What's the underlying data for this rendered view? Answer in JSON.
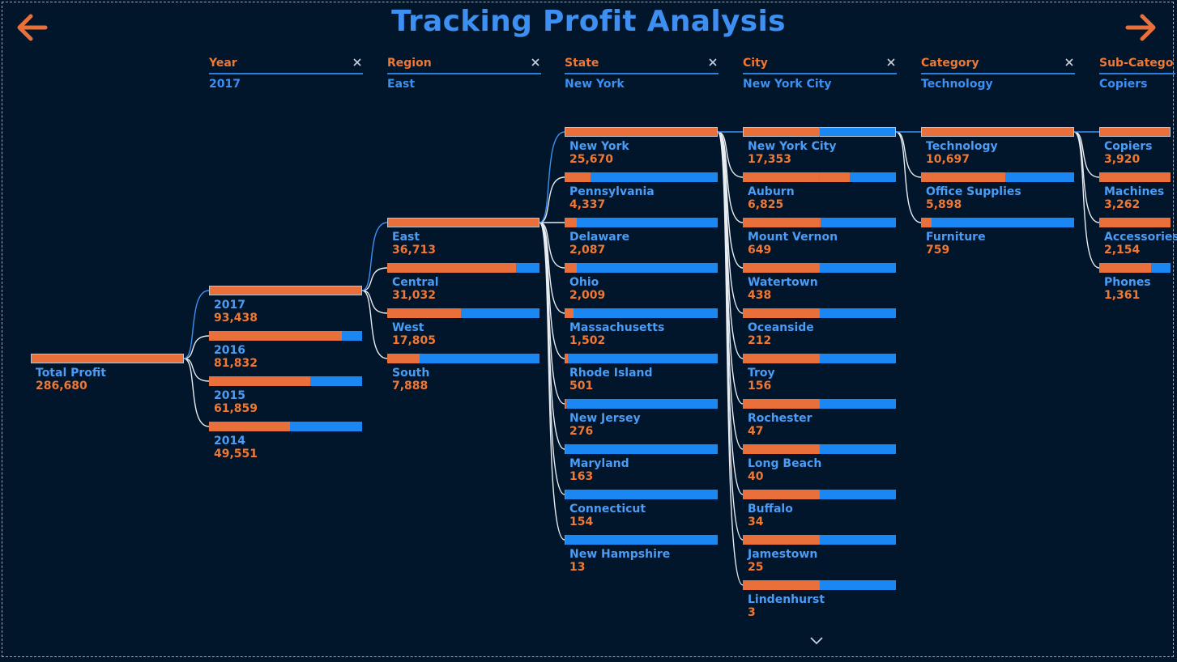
{
  "title": "Tracking Profit Analysis",
  "colors": {
    "background": "#01162b",
    "profit": "#e9703a",
    "bar_base": "#1a87f2",
    "title": "#3d8ff2",
    "label": "#f07835"
  },
  "icons": {
    "back": "arrow-left-icon",
    "forward": "arrow-right-icon",
    "close": "close-icon",
    "scroll": "chevron-down-icon"
  },
  "levels": [
    {
      "header": "",
      "selected": "",
      "nodes": [
        {
          "name": "Total Profit",
          "value": "286,680",
          "fill": 1.0,
          "active": true
        }
      ]
    },
    {
      "header": "Year",
      "selected": "2017",
      "nodes": [
        {
          "name": "2017",
          "value": "93,438",
          "fill": 1.0,
          "active": true
        },
        {
          "name": "2016",
          "value": "81,832",
          "fill": 0.87,
          "active": false
        },
        {
          "name": "2015",
          "value": "61,859",
          "fill": 0.66,
          "active": false
        },
        {
          "name": "2014",
          "value": "49,551",
          "fill": 0.53,
          "active": false
        }
      ]
    },
    {
      "header": "Region",
      "selected": "East",
      "nodes": [
        {
          "name": "East",
          "value": "36,713",
          "fill": 1.0,
          "active": true
        },
        {
          "name": "Central",
          "value": "31,032",
          "fill": 0.845,
          "active": false
        },
        {
          "name": "West",
          "value": "17,805",
          "fill": 0.485,
          "active": false
        },
        {
          "name": "South",
          "value": "7,888",
          "fill": 0.215,
          "active": false
        }
      ]
    },
    {
      "header": "State",
      "selected": "New York",
      "nodes": [
        {
          "name": "New York",
          "value": "25,670",
          "fill": 1.0,
          "active": true
        },
        {
          "name": "Pennsylvania",
          "value": "4,337",
          "fill": 0.169,
          "active": false
        },
        {
          "name": "Delaware",
          "value": "2,087",
          "fill": 0.081,
          "active": false
        },
        {
          "name": "Ohio",
          "value": "2,009",
          "fill": 0.078,
          "active": false
        },
        {
          "name": "Massachusetts",
          "value": "1,502",
          "fill": 0.059,
          "active": false
        },
        {
          "name": "Rhode Island",
          "value": "501",
          "fill": 0.02,
          "active": false
        },
        {
          "name": "New Jersey",
          "value": "276",
          "fill": 0.011,
          "active": false
        },
        {
          "name": "Maryland",
          "value": "163",
          "fill": 0.006,
          "active": false
        },
        {
          "name": "Connecticut",
          "value": "154",
          "fill": 0.006,
          "active": false
        },
        {
          "name": "New Hampshire",
          "value": "13",
          "fill": 0.0005,
          "active": false
        }
      ]
    },
    {
      "header": "City",
      "selected": "New York City",
      "nodes": [
        {
          "name": "New York City",
          "value": "17,353",
          "fill": 0.5,
          "active": true
        },
        {
          "name": "Auburn",
          "value": "6,825",
          "fill": 0.7,
          "active": false
        },
        {
          "name": "Mount Vernon",
          "value": "649",
          "fill": 0.51,
          "active": false
        },
        {
          "name": "Watertown",
          "value": "438",
          "fill": 0.505,
          "active": false
        },
        {
          "name": "Oceanside",
          "value": "212",
          "fill": 0.5,
          "active": false
        },
        {
          "name": "Troy",
          "value": "156",
          "fill": 0.5,
          "active": false
        },
        {
          "name": "Rochester",
          "value": "47",
          "fill": 0.5,
          "active": false
        },
        {
          "name": "Long Beach",
          "value": "40",
          "fill": 0.5,
          "active": false
        },
        {
          "name": "Buffalo",
          "value": "34",
          "fill": 0.5,
          "active": false
        },
        {
          "name": "Jamestown",
          "value": "25",
          "fill": 0.5,
          "active": false
        },
        {
          "name": "Lindenhurst",
          "value": "3",
          "fill": 0.5,
          "active": false
        }
      ]
    },
    {
      "header": "Category",
      "selected": "Technology",
      "nodes": [
        {
          "name": "Technology",
          "value": "10,697",
          "fill": 1.0,
          "active": true
        },
        {
          "name": "Office Supplies",
          "value": "5,898",
          "fill": 0.551,
          "active": false
        },
        {
          "name": "Furniture",
          "value": "759",
          "fill": 0.071,
          "active": false
        }
      ]
    },
    {
      "header": "Sub-Catego",
      "selected": "Copiers",
      "nodes": [
        {
          "name": "Copiers",
          "value": "3,920",
          "fill": 1.0,
          "active": true
        },
        {
          "name": "Machines",
          "value": "3,262",
          "fill": 1.0,
          "active": false
        },
        {
          "name": "Accessories",
          "value": "2,154",
          "fill": 1.0,
          "active": false
        },
        {
          "name": "Phones",
          "value": "1,361",
          "fill": 0.73,
          "active": false
        }
      ]
    }
  ]
}
